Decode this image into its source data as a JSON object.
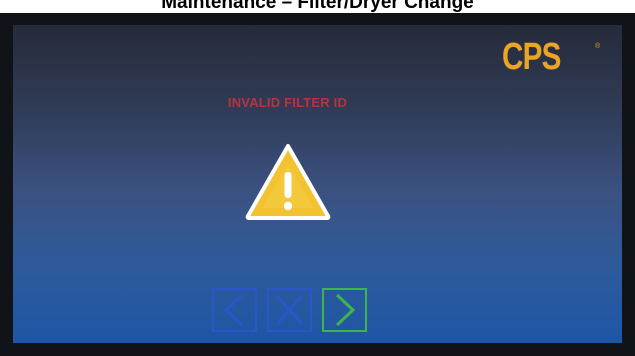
{
  "page": {
    "title": "Maintenance – Filter/Dryer Change"
  },
  "header": {
    "logo_text": "CPS",
    "logo_mark": "®"
  },
  "message": {
    "error_text": "INVALID FILTER ID",
    "icon": "warning-triangle-icon"
  },
  "navigation": {
    "back_icon": "chevron-left-icon",
    "cancel_icon": "x-icon",
    "next_icon": "chevron-right-icon"
  },
  "colors": {
    "logo": "#e9a523",
    "error_text": "#b8343c",
    "warning_fill": "#f2c230",
    "nav_blue": "#2b55c8",
    "nav_green": "#3fb44a"
  }
}
